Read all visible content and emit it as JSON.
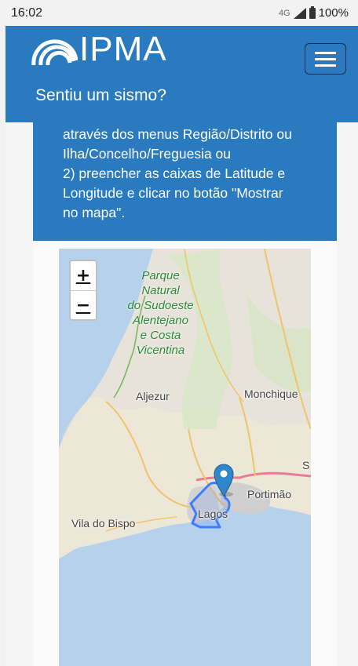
{
  "status_bar": {
    "time": "16:02",
    "network": "4G",
    "battery": "100%"
  },
  "header": {
    "logo_text": "IPMA",
    "title": "Sentiu um sismo?",
    "brand_color": "#2a7ac0"
  },
  "info": {
    "lines": [
      "através dos menus Região/Distrito ou",
      "Ilha/Concelho/Freguesia ou",
      "2) preencher as caixas de Latitude e",
      "Longitude e clicar no botão \"Mostrar",
      "no mapa\"."
    ]
  },
  "map": {
    "zoom_in": "+",
    "zoom_out": "−",
    "park_lines": [
      "Parque",
      "Natural",
      "do Sudoeste",
      "Alentejano",
      "e Costa",
      "Vicentina"
    ],
    "labels": {
      "aljezur": "Aljezur",
      "monchique": "Monchique",
      "portimao": "Portimão",
      "lagos": "Lagos",
      "vila_do_bispo": "Vila do Bispo",
      "edge_s": "S"
    },
    "marker_icon": "map-pin-icon",
    "highlight_color": "#3d7bff"
  }
}
